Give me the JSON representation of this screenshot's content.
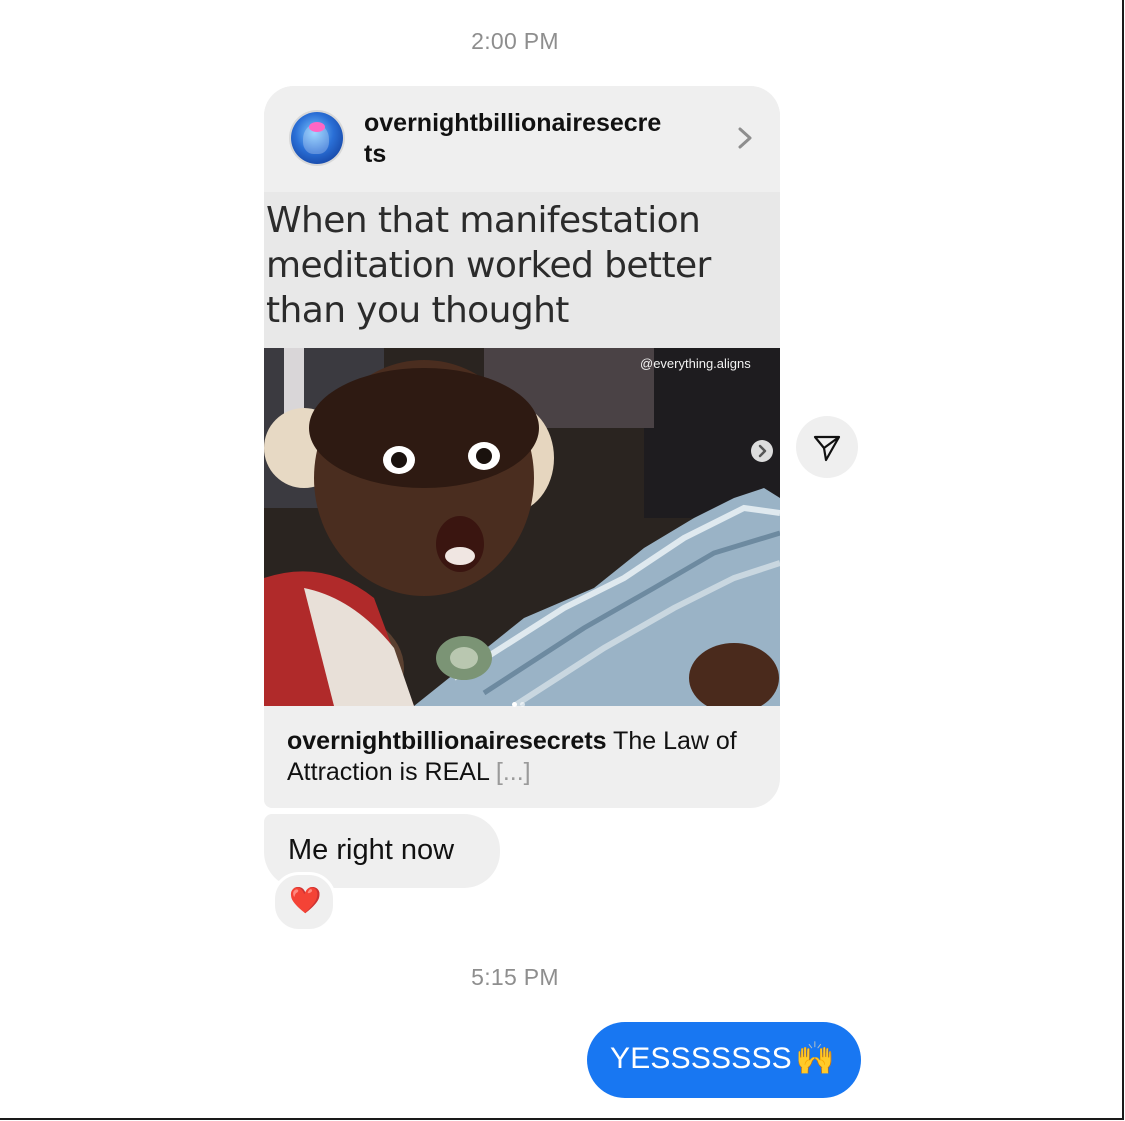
{
  "conversation": {
    "timestamp_1": "2:00 PM",
    "timestamp_2": "5:15 PM"
  },
  "shared_post": {
    "username": "overnightbillionairesecrets",
    "username_display_line1": "overnightbillionairesecre",
    "username_display_line2": "ts",
    "meme_caption": "When that manifestation meditation worked better than you thought",
    "watermark": "@everything.aligns",
    "carousel": {
      "current": 1,
      "total": 2
    },
    "footer_author": "overnightbillionairesecrets",
    "footer_text": "The Law of Attraction is REAL",
    "footer_more": "[...]",
    "icons": {
      "avatar": "profile-avatar-icon",
      "chevron": "chevron-right-icon",
      "carousel_next": "carousel-next-icon",
      "share": "paper-plane-share-icon"
    }
  },
  "messages": [
    {
      "from": "them",
      "text": "Me right now",
      "reaction": "❤️"
    },
    {
      "from": "me",
      "text": "YESSSSSSS",
      "emoji": "🙌"
    }
  ],
  "colors": {
    "sent_bubble": "#1877f2",
    "received_bubble": "#efefef",
    "timestamp": "#8e8e8e"
  }
}
